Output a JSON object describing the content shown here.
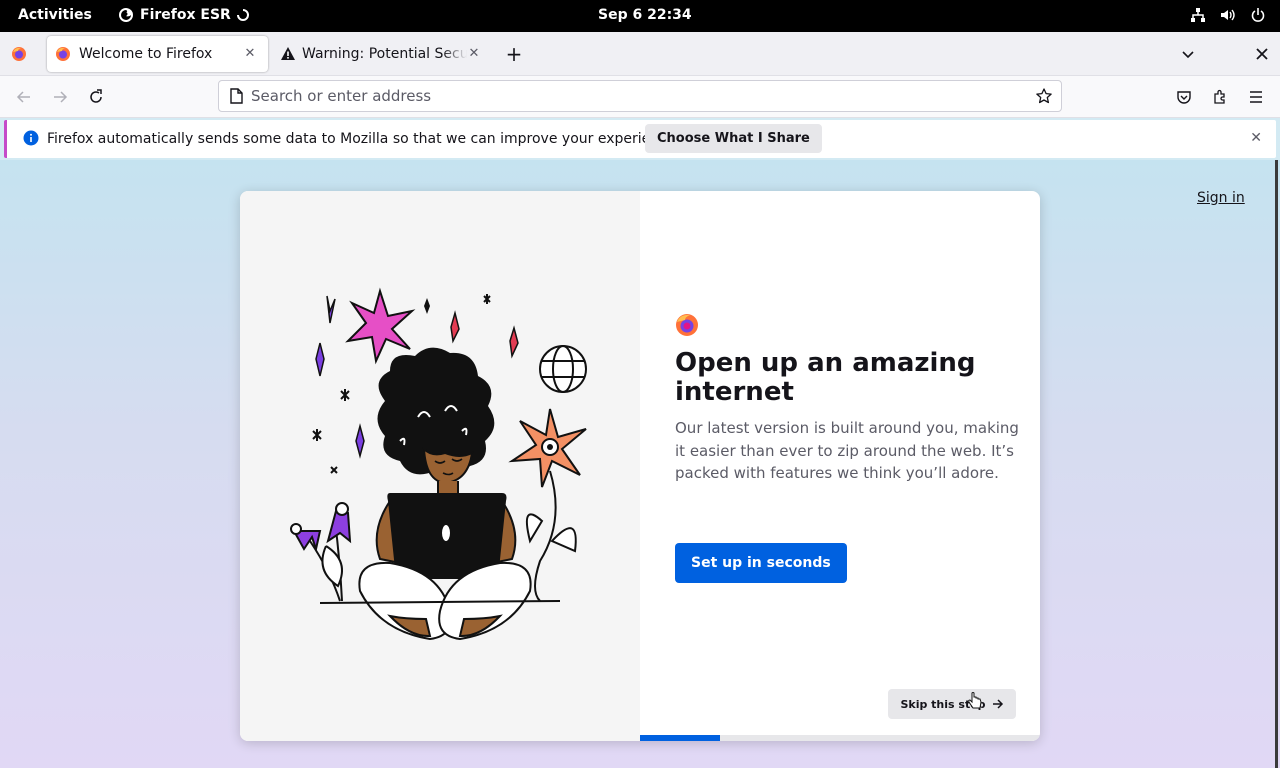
{
  "topbar": {
    "activities": "Activities",
    "app_name": "Firefox ESR",
    "clock": "Sep 6  22:34",
    "tray_icons": [
      "network-icon",
      "volume-icon",
      "power-icon"
    ]
  },
  "tabs": [
    {
      "title": "Welcome to Firefox",
      "icon": "firefox-icon",
      "active": true
    },
    {
      "title": "Warning: Potential Secur",
      "icon": "warning-icon",
      "active": false
    }
  ],
  "navbar": {
    "url_placeholder": "Search or enter address",
    "url_value": ""
  },
  "notification": {
    "message": "Firefox automatically sends some data to Mozilla so that we can improve your experience.",
    "action_label": "Choose What I Share"
  },
  "page": {
    "sign_in": "Sign in",
    "heading": "Open up an amazing internet",
    "subtitle": "Our latest version is built around you, making it easier than ever to zip around the web. It’s packed with features we think you’ll adore.",
    "primary_button": "Set up in seconds",
    "skip_button": "Skip this step",
    "progress": 0.2
  },
  "colors": {
    "accent": "#0061e0",
    "notification_accent": "#c54bc9"
  }
}
